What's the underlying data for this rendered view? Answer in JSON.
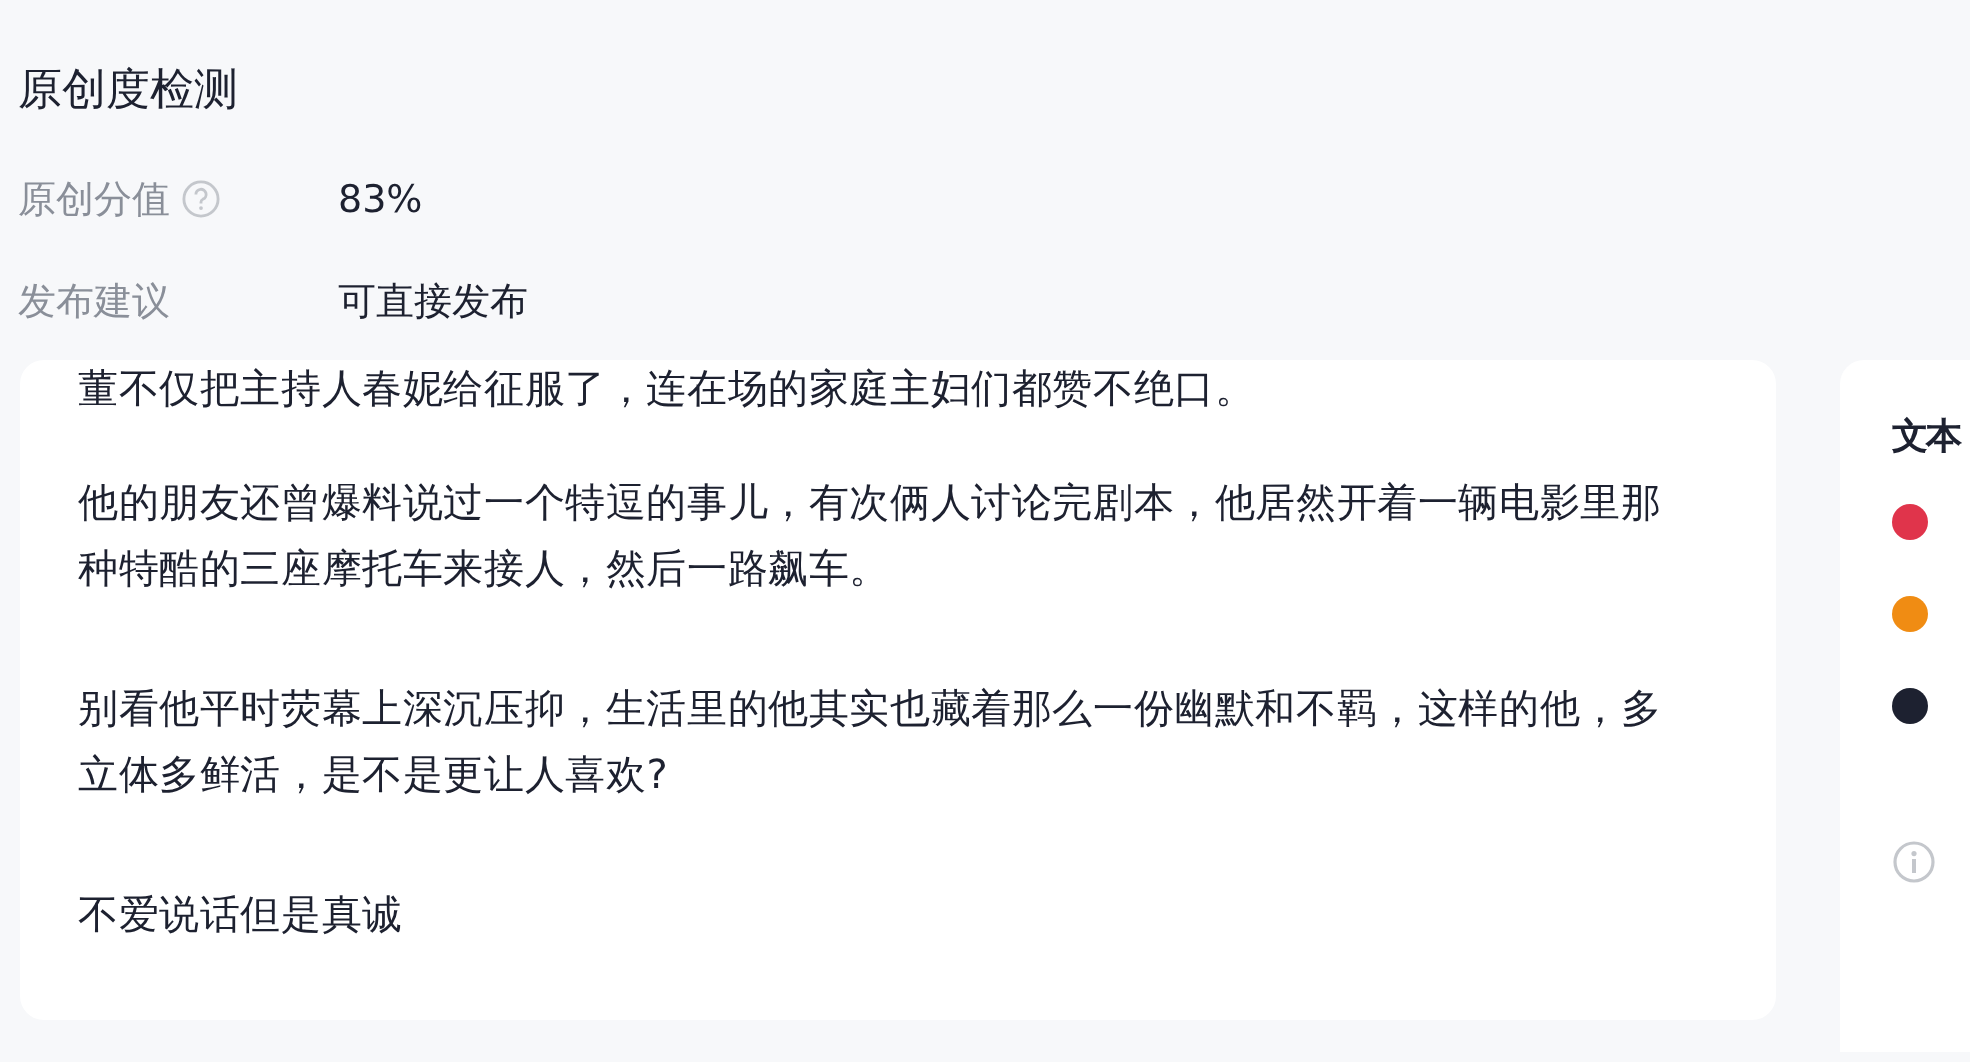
{
  "title": "原创度检测",
  "fields": [
    {
      "label": "原创分值",
      "help": true,
      "value": "83%"
    },
    {
      "label": "发布建议",
      "help": false,
      "value": "可直接发布"
    }
  ],
  "article": {
    "paragraphs": [
      "董不仅把主持人春妮给征服了，连在场的家庭主妇们都赞不绝口。",
      "他的朋友还曾爆料说过一个特逗的事儿，有次俩人讨论完剧本，他居然开着一辆电影里那种特酷的三座摩托车来接人，然后一路飙车。",
      "别看他平时荧幕上深沉压抑，生活里的他其实也藏着那么一份幽默和不羁，这样的他，多立体多鲜活，是不是更让人喜欢?",
      "不爱说话但是真诚"
    ]
  },
  "side_panel": {
    "title": "文本",
    "legend": [
      {
        "color": "#e0344b"
      },
      {
        "color": "#f08c13"
      },
      {
        "color": "#1d2130"
      }
    ]
  }
}
